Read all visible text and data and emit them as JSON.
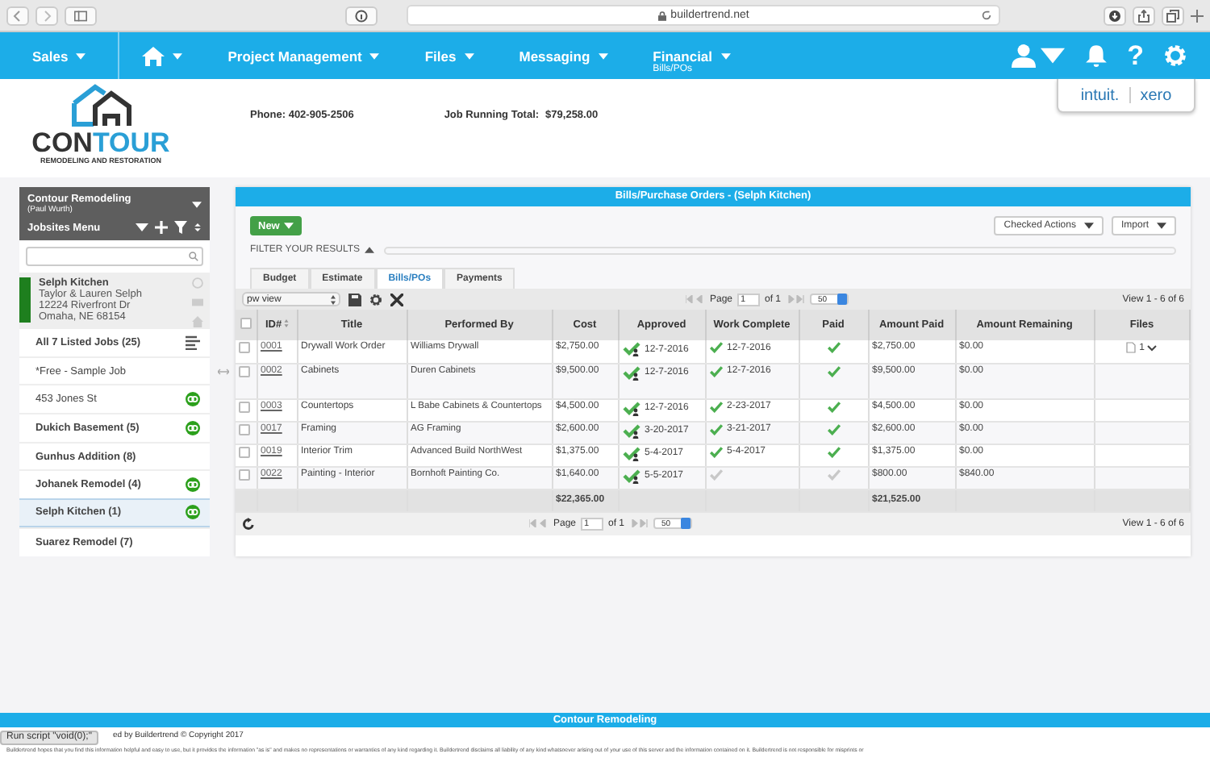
{
  "browser": {
    "url": "buildertrend.net"
  },
  "nav": {
    "items": [
      {
        "kind": "text",
        "label": "Sales"
      },
      {
        "kind": "home"
      },
      {
        "kind": "text",
        "label": "Project Management"
      },
      {
        "kind": "text",
        "label": "Files"
      },
      {
        "kind": "text",
        "label": "Messaging"
      },
      {
        "kind": "text",
        "label": "Financial",
        "sub": "Bills/POs"
      }
    ],
    "help": "?"
  },
  "header": {
    "logo": {
      "parts": [
        "CON",
        "TOUR"
      ],
      "tagline": "REMODELING AND RESTORATION"
    },
    "phone": "Phone: 402-905-2506",
    "total_label": "Job Running Total:",
    "total": "$79,258.00",
    "integrations": [
      "intuit.",
      "xero"
    ]
  },
  "sidebar": {
    "company": "Contour Remodeling",
    "user": "(Paul Wurth)",
    "menu_title": "Jobsites Menu",
    "current": {
      "name": "Selph Kitchen",
      "lines": [
        "Taylor & Lauren Selph",
        "12224 Riverfront Dr",
        "Omaha, NE 68154"
      ]
    },
    "jobs": [
      {
        "kind": "summary",
        "label": "All 7 Listed Jobs (25)",
        "bold": true,
        "synced": false,
        "selected": false
      },
      {
        "kind": "job",
        "label": "*Free - Sample Job",
        "bold": false,
        "synced": false,
        "selected": false
      },
      {
        "kind": "job",
        "label": "453 Jones St",
        "bold": false,
        "synced": true,
        "selected": false
      },
      {
        "kind": "job",
        "label": "Dukich Basement (5)",
        "bold": true,
        "synced": true,
        "selected": false
      },
      {
        "kind": "job",
        "label": "Gunhus Addition (8)",
        "bold": true,
        "synced": false,
        "selected": false
      },
      {
        "kind": "job",
        "label": "Johanek Remodel (4)",
        "bold": true,
        "synced": true,
        "selected": false
      },
      {
        "kind": "job",
        "label": "Selph Kitchen (1)",
        "bold": true,
        "synced": true,
        "selected": true
      },
      {
        "kind": "job",
        "label": "Suarez Remodel (7)",
        "bold": true,
        "synced": false,
        "selected": false
      }
    ]
  },
  "panel": {
    "title": "Bills/Purchase Orders - (Selph Kitchen)",
    "new_button": "New",
    "actions": [
      "Checked Actions",
      "Import"
    ],
    "filter": "FILTER YOUR RESULTS",
    "tabs": [
      {
        "label": "Budget",
        "selected": false
      },
      {
        "label": "Estimate",
        "selected": false
      },
      {
        "label": "Bills/POs",
        "selected": true
      },
      {
        "label": "Payments",
        "selected": false
      }
    ],
    "view": "pw view",
    "pagers": [
      {
        "page_label": "Page",
        "page": "1",
        "of": "of 1",
        "per_page": "50",
        "summary": "View 1 - 6 of 6"
      },
      {
        "page_label": "Page",
        "page": "1",
        "of": "of 1",
        "per_page": "50",
        "summary": "View 1 - 6 of 6"
      }
    ],
    "table": {
      "header_checked": false,
      "columns": [
        "ID#",
        "Title",
        "Performed By",
        "Cost",
        "Approved",
        "Work Complete",
        "Paid",
        "Amount Paid",
        "Amount Remaining",
        "Files"
      ],
      "rows": [
        {
          "checked": false,
          "id": "0001",
          "title": "Drywall Work Order",
          "performed_by": "Williams Drywall",
          "cost": "$2,750.00",
          "approved": "12-7-2016",
          "work_complete": true,
          "completed": "12-7-2016",
          "paid": true,
          "amount_paid": "$2,750.00",
          "amount_remaining": "$0.00",
          "files": "1",
          "tall": false
        },
        {
          "checked": false,
          "id": "0002",
          "title": "Cabinets",
          "performed_by": "Duren Cabinets",
          "cost": "$9,500.00",
          "approved": "12-7-2016",
          "work_complete": true,
          "completed": "12-7-2016",
          "paid": true,
          "amount_paid": "$9,500.00",
          "amount_remaining": "$0.00",
          "tall": true
        },
        {
          "checked": false,
          "id": "0003",
          "title": "Countertops",
          "performed_by": "L Babe Cabinets & Countertops",
          "cost": "$4,500.00",
          "approved": "12-7-2016",
          "work_complete": true,
          "completed": "2-23-2017",
          "paid": true,
          "amount_paid": "$4,500.00",
          "amount_remaining": "$0.00",
          "tall": false
        },
        {
          "checked": false,
          "id": "0017",
          "title": "Framing",
          "performed_by": "AG Framing",
          "cost": "$2,600.00",
          "approved": "3-20-2017",
          "work_complete": true,
          "completed": "3-21-2017",
          "paid": true,
          "amount_paid": "$2,600.00",
          "amount_remaining": "$0.00",
          "tall": false
        },
        {
          "checked": false,
          "id": "0019",
          "title": "Interior Trim",
          "performed_by": "Advanced Build NorthWest",
          "cost": "$1,375.00",
          "approved": "5-4-2017",
          "work_complete": true,
          "completed": "5-4-2017",
          "paid": true,
          "amount_paid": "$1,375.00",
          "amount_remaining": "$0.00",
          "tall": false
        },
        {
          "checked": false,
          "id": "0022",
          "title": "Painting - Interior",
          "performed_by": "Bornhoft Painting Co.",
          "cost": "$1,640.00",
          "approved": "5-5-2017",
          "work_complete": false,
          "paid": false,
          "amount_paid": "$800.00",
          "amount_remaining": "$840.00",
          "tall": false
        }
      ],
      "totals": {
        "cost": "$22,365.00",
        "amount_paid": "$21,525.00"
      }
    }
  },
  "footer": {
    "company": "Contour Remodeling",
    "copyright": "ed by Buildertrend © Copyright 2017",
    "status": "Run script \"void(0);\"",
    "disclaimer": "Buildertrend hopes that you find this information helpful and easy to use, but it provides the information \"as is\" and makes no representations or warranties of any kind regarding it. Buildertrend disclaims all liability of any kind whatsoever arising out of your use of this server and the information contained on it. Buildertrend is not responsible for misprints or"
  }
}
